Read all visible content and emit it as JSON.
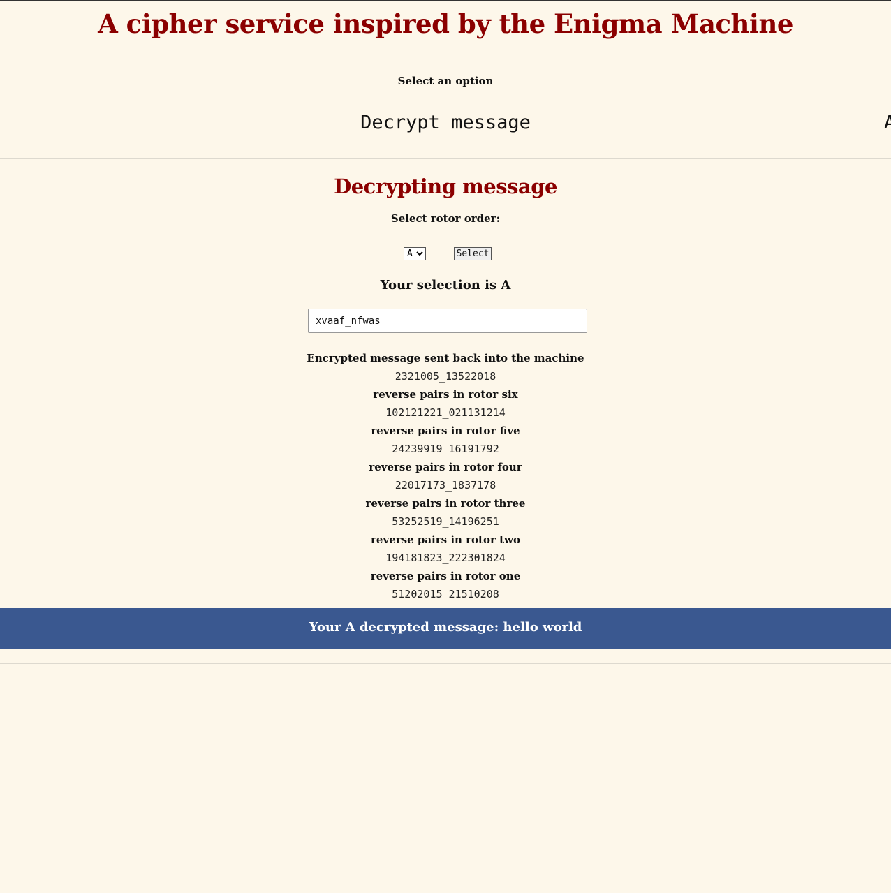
{
  "header": {
    "title": "A cipher service inspired by the Enigma Machine"
  },
  "options": {
    "label": "Select an option",
    "decrypt": "Decrypt message",
    "second_partial": "A"
  },
  "decrypt": {
    "heading": "Decrypting message",
    "rotor_label": "Select rotor order:",
    "rotor_selected": "A",
    "select_button": "Select",
    "selection_text": "Your selection is A",
    "input_value": "xvaaf_nfwas"
  },
  "steps": [
    {
      "label": "Encrypted message sent back into the machine",
      "value": "2321005_13522018"
    },
    {
      "label": "reverse pairs in rotor six",
      "value": "102121221_021131214"
    },
    {
      "label": "reverse pairs in rotor five",
      "value": "24239919_16191792"
    },
    {
      "label": "reverse pairs in rotor four",
      "value": "22017173_1837178"
    },
    {
      "label": "reverse pairs in rotor three",
      "value": "53252519_14196251"
    },
    {
      "label": "reverse pairs in rotor two",
      "value": "194181823_222301824"
    },
    {
      "label": "reverse pairs in rotor one",
      "value": "51202015_21510208"
    }
  ],
  "result": {
    "text": "Your A decrypted message: hello world"
  }
}
